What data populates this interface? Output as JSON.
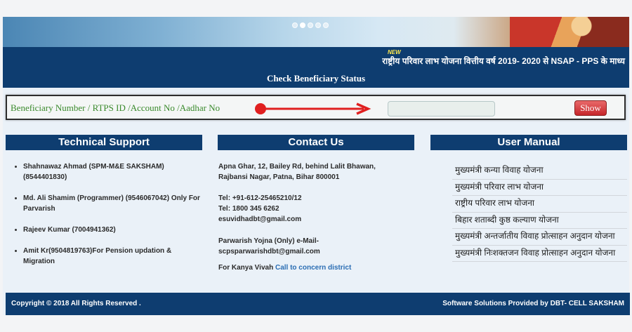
{
  "banner": {
    "slide_count": 5,
    "active_slide": 1
  },
  "news": {
    "badge": "NEW",
    "ticker": "राष्ट्रीय परिवार लाभ योजना वित्तीय वर्ष 2019- 2020 से NSAP - PPS के माध्य"
  },
  "check": {
    "title": "Check Beneficiary Status",
    "label": "Beneficiary Number / RTPS ID /Account No /Aadhar No",
    "input_value": "",
    "show_label": "Show"
  },
  "tech_support": {
    "heading": "Technical Support",
    "items": [
      "Shahnawaz Ahmad (SPM-M&E SAKSHAM) (8544401830)",
      "Md. Ali Shamim (Programmer) (9546067042) Only For Parvarish",
      "Rajeev Kumar (7004941362)",
      "Amit Kr(9504819763)For Pension updation & Migration"
    ]
  },
  "contact": {
    "heading": "Contact Us",
    "address_1": "Apna Ghar, 12, Bailey Rd, behind Lalit Bhawan,",
    "address_2": "Rajbansi Nagar, Patna, Bihar 800001",
    "tel_1": "Tel: +91-612-25465210/12",
    "tel_2": "Tel: 1800 345 6262",
    "email": "esuvidhadbt@gmail.com",
    "parwarish_1": "Parwarish Yojna (Only) e-Mail-",
    "parwarish_2": "scpsparwarishdbt@gmail.com",
    "kanya_prefix": "For Kanya Vivah",
    "kanya_link": "Call to concern district"
  },
  "user_manual": {
    "heading": "User Manual",
    "items": [
      "मुख्यमंत्री कन्या विवाह योजना",
      "मुख्यमंत्री परिवार लाभ योजना",
      "राष्ट्रीय परिवार लाभ योजना",
      "बिहार शताब्दी कुष्ठ कल्याण योजना",
      "मुख्यमंत्री अन्तर्जातीय विवाह प्रोत्साहन अनुदान योजना",
      "मुख्यमंत्री निःशक्तजन विवाह प्रोत्साहन अनुदान योजना"
    ]
  },
  "footer": {
    "copyright": "Copyright © 2018 All Rights Reserved .",
    "credits": "Software Solutions Provided by DBT- CELL SAKSHAM"
  },
  "colors": {
    "navy": "#0e3d70",
    "label_green": "#3a8a2c",
    "arrow_red": "#e02020",
    "link_blue": "#2a6db3"
  }
}
